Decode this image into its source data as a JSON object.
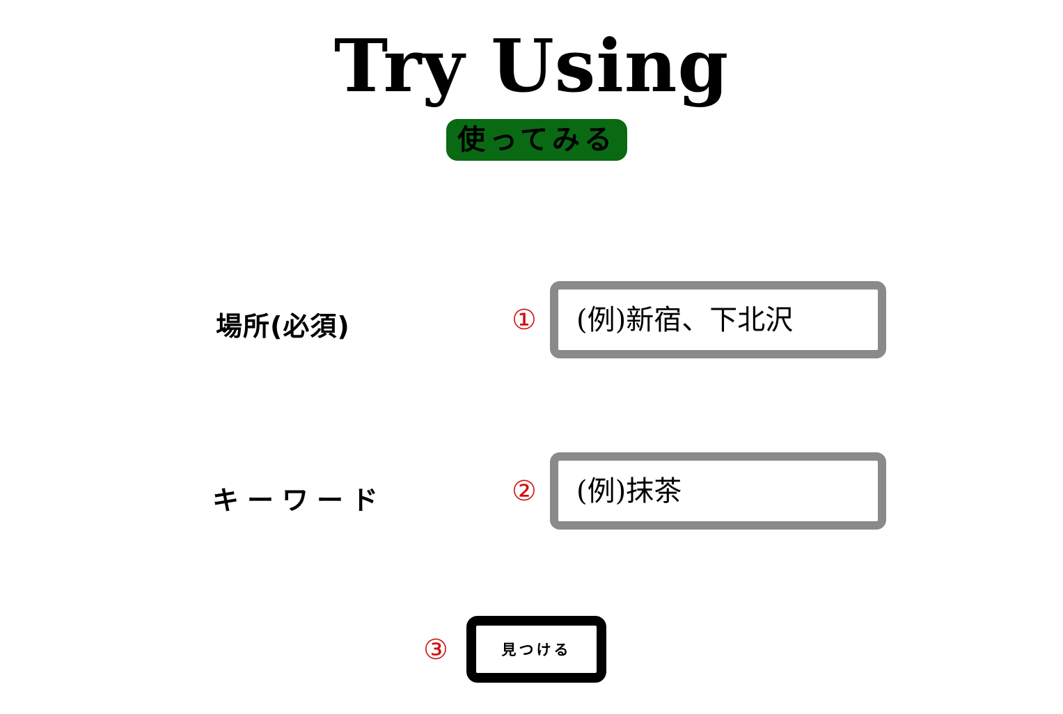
{
  "header": {
    "title": "Try Using",
    "subtitle": "使ってみる",
    "subtitle_bg_color": "#0a6a14"
  },
  "form": {
    "place": {
      "label": "場所(必須)",
      "step_number": "①",
      "placeholder": "(例)新宿、下北沢"
    },
    "keyword": {
      "label": "キーワード",
      "step_number": "②",
      "placeholder": "(例)抹茶"
    },
    "submit": {
      "step_number": "③",
      "label": "見つける"
    },
    "step_number_color": "#d01010",
    "input_border_color": "#8a8a8a"
  }
}
